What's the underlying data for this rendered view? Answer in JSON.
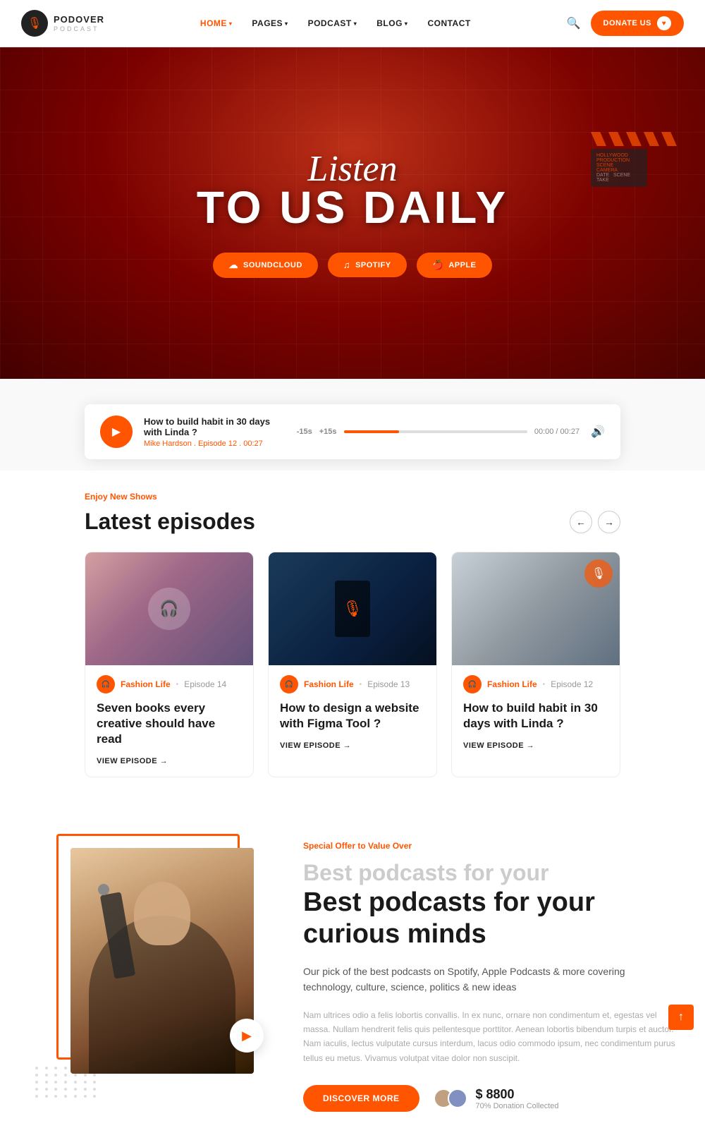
{
  "brand": {
    "name": "PODOVER",
    "sub": "PODCAST",
    "icon": "🎙"
  },
  "nav": {
    "links": [
      {
        "label": "HOME",
        "active": true,
        "has_dropdown": true
      },
      {
        "label": "PAGES",
        "active": false,
        "has_dropdown": true
      },
      {
        "label": "PODCAST",
        "active": false,
        "has_dropdown": true
      },
      {
        "label": "BLOG",
        "active": false,
        "has_dropdown": true
      },
      {
        "label": "CONTACT",
        "active": false,
        "has_dropdown": false
      }
    ],
    "donate_label": "DONATE US"
  },
  "hero": {
    "listen_text": "Listen",
    "tagline": "TO US DAILY",
    "buttons": [
      {
        "label": "SOUNDCLOUD",
        "icon": "☁"
      },
      {
        "label": "SPOTIFY",
        "icon": "♫"
      },
      {
        "label": "APPLE",
        "icon": ""
      }
    ]
  },
  "player": {
    "title": "How to build habit in 30 days with Linda ?",
    "meta": "Mike Hardson . Episode 12 . 00:27",
    "rewind": "-15s",
    "forward": "+15s",
    "time_current": "00:00",
    "time_total": "00:27",
    "progress_pct": 30
  },
  "episodes": {
    "label": "Enjoy New Shows",
    "title": "Latest episodes",
    "items": [
      {
        "category": "Fashion Life",
        "episode_num": "Episode 14",
        "title": "Seven books every creative should have read",
        "view_label": "VIEW EPISODE →",
        "thumb_class": "thumb-1"
      },
      {
        "category": "Fashion Life",
        "episode_num": "Episode 13",
        "title": "How to design a website with Figma Tool ?",
        "view_label": "VIEW EPISODE →",
        "thumb_class": "thumb-2"
      },
      {
        "category": "Fashion Life",
        "episode_num": "Episode 12",
        "title": "How to build habit in 30 days with Linda ?",
        "view_label": "VIEW EPISODE →",
        "thumb_class": "thumb-3"
      }
    ]
  },
  "promo": {
    "label": "Special Offer to Value Over",
    "subtitle": "Best podcasts for your",
    "title": "Best podcasts for your curious minds",
    "description": "Our pick of the best podcasts on Spotify, Apple Podcasts & more covering technology, culture, science, politics & new ideas",
    "lorem": "Nam ultrices odio a felis lobortis convallis. In ex nunc, ornare non condimentum et, egestas vel massa. Nullam hendrerit felis quis pellentesque porttitor. Aenean lobortis bibendum turpis et auctor. Nam iaculis, lectus vulputate cursus interdum, lacus odio commodo ipsum, nec condimentum purus tellus eu metus. Vivamus volutpat vitae dolor non suscipit.",
    "discover_label": "DISCOVER MORE",
    "donation_amount": "$ 8800",
    "donation_label": "70% Donation Collected"
  }
}
